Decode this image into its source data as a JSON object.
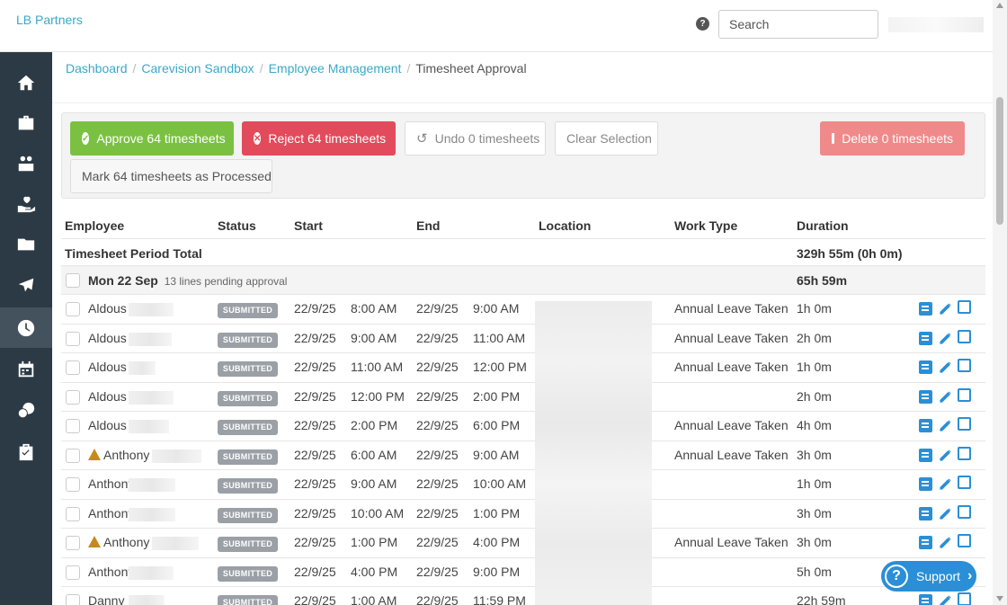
{
  "header": {
    "brand": "LB Partners",
    "help_icon": "?",
    "search_placeholder": "Search"
  },
  "sidebar": {
    "items": [
      {
        "icon": "home-icon"
      },
      {
        "icon": "briefcase-icon"
      },
      {
        "icon": "people-icon"
      },
      {
        "icon": "hand-heart-icon"
      },
      {
        "icon": "folder-icon"
      },
      {
        "icon": "plane-icon"
      },
      {
        "icon": "clock-icon",
        "active": true
      },
      {
        "icon": "calendar-icon"
      },
      {
        "icon": "coins-icon"
      },
      {
        "icon": "clipboard-icon"
      }
    ]
  },
  "breadcrumb": {
    "items": [
      "Dashboard",
      "Carevision Sandbox",
      "Employee Management"
    ],
    "current": "Timesheet Approval"
  },
  "toolbar": {
    "approve": "Approve 64 timesheets",
    "reject": "Reject 64 timesheets",
    "undo": "Undo 0 timesheets",
    "clear": "Clear Selection",
    "delete": "Delete 0 timesheets",
    "processed": "Mark 64 timesheets as Processed"
  },
  "colors": {
    "approve": "#7ac142",
    "reject": "#e24b5b",
    "delete": "#f08a8a",
    "sidebar": "#2c3a45",
    "accent": "#3aa8c9",
    "support": "#2a8fd6"
  },
  "table": {
    "columns": [
      "Employee",
      "Status",
      "Start",
      "End",
      "Location",
      "Work Type",
      "Duration"
    ],
    "period_total_label": "Timesheet Period Total",
    "period_total_value": "329h 55m (0h 0m)",
    "day_group": {
      "label": "Mon 22 Sep",
      "sub": "13 lines pending approval",
      "duration": "65h 59m"
    },
    "rows": [
      {
        "name": "Aldous",
        "warn": false,
        "status": "SUBMITTED",
        "start_date": "22/9/25",
        "start_time": "8:00 AM",
        "end_date": "22/9/25",
        "end_time": "9:00 AM",
        "work_type": "Annual Leave Taken",
        "duration": "1h 0m"
      },
      {
        "name": "Aldous",
        "warn": false,
        "status": "SUBMITTED",
        "start_date": "22/9/25",
        "start_time": "9:00 AM",
        "end_date": "22/9/25",
        "end_time": "11:00 AM",
        "work_type": "Annual Leave Taken",
        "duration": "2h 0m"
      },
      {
        "name": "Aldous",
        "warn": false,
        "status": "SUBMITTED",
        "start_date": "22/9/25",
        "start_time": "11:00 AM",
        "end_date": "22/9/25",
        "end_time": "12:00 PM",
        "work_type": "Annual Leave Taken",
        "duration": "1h 0m"
      },
      {
        "name": "Aldous",
        "warn": false,
        "status": "SUBMITTED",
        "start_date": "22/9/25",
        "start_time": "12:00 PM",
        "end_date": "22/9/25",
        "end_time": "2:00 PM",
        "work_type": "",
        "duration": "2h 0m"
      },
      {
        "name": "Aldous",
        "warn": false,
        "status": "SUBMITTED",
        "start_date": "22/9/25",
        "start_time": "2:00 PM",
        "end_date": "22/9/25",
        "end_time": "6:00 PM",
        "work_type": "Annual Leave Taken",
        "duration": "4h 0m"
      },
      {
        "name": "Anthony",
        "warn": true,
        "status": "SUBMITTED",
        "start_date": "22/9/25",
        "start_time": "6:00 AM",
        "end_date": "22/9/25",
        "end_time": "9:00 AM",
        "work_type": "Annual Leave Taken",
        "duration": "3h 0m"
      },
      {
        "name": "Anthony .",
        "warn": false,
        "status": "SUBMITTED",
        "start_date": "22/9/25",
        "start_time": "9:00 AM",
        "end_date": "22/9/25",
        "end_time": "10:00 AM",
        "work_type": "",
        "duration": "1h 0m"
      },
      {
        "name": "Anthony .",
        "warn": false,
        "status": "SUBMITTED",
        "start_date": "22/9/25",
        "start_time": "10:00 AM",
        "end_date": "22/9/25",
        "end_time": "1:00 PM",
        "work_type": "",
        "duration": "3h 0m"
      },
      {
        "name": "Anthony",
        "warn": true,
        "status": "SUBMITTED",
        "start_date": "22/9/25",
        "start_time": "1:00 PM",
        "end_date": "22/9/25",
        "end_time": "4:00 PM",
        "work_type": "Annual Leave Taken",
        "duration": "3h 0m"
      },
      {
        "name": "Anthony",
        "warn": false,
        "status": "SUBMITTED",
        "start_date": "22/9/25",
        "start_time": "4:00 PM",
        "end_date": "22/9/25",
        "end_time": "9:00 PM",
        "work_type": "",
        "duration": "5h 0m"
      },
      {
        "name": "Danny",
        "warn": false,
        "status": "SUBMITTED",
        "start_date": "22/9/25",
        "start_time": "1:00 AM",
        "end_date": "22/9/25",
        "end_time": "11:59 PM",
        "work_type": "",
        "duration": "22h 59m"
      }
    ]
  },
  "support": {
    "label": "Support",
    "icon": "?"
  }
}
